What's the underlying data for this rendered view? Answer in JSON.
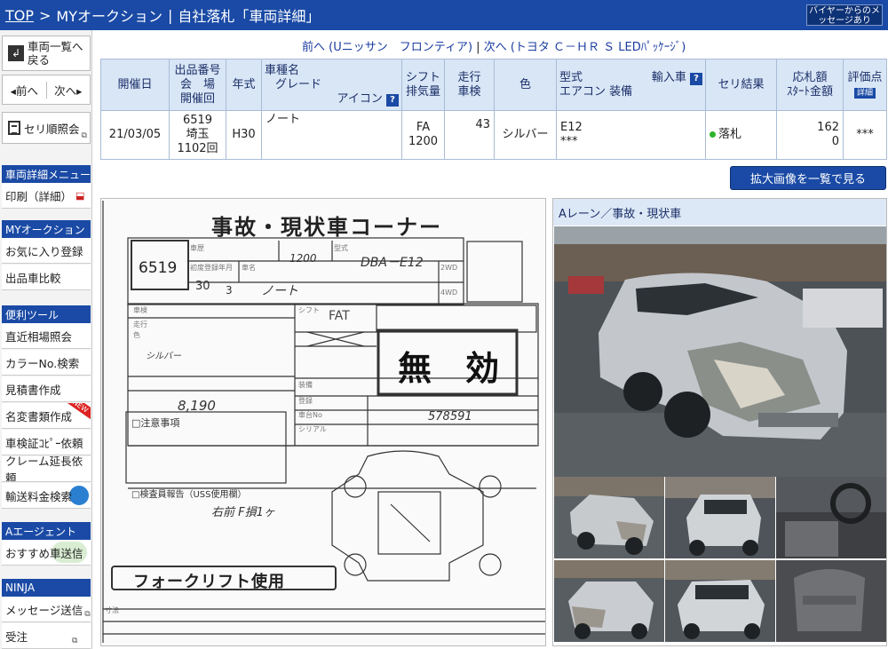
{
  "header": {
    "top": "TOP",
    "sep1": ">",
    "page": "MYオークション",
    "sep2": "|",
    "title": "自社落札「車両詳細」",
    "message_btn": "バイヤーからのメッセージあり"
  },
  "sidebar": {
    "back": "車両一覧へ戻る",
    "prev": "◂前へ",
    "next": "次へ▸",
    "seri": "セリ順照会",
    "menu_head": "車両詳細メニュー",
    "print": "印刷（詳細）",
    "myauction_head": "MYオークション",
    "favorite": "お気に入り登録",
    "compare": "出品車比較",
    "tools_head": "便利ツール",
    "market": "直近相場照会",
    "color_search": "カラーNo.検索",
    "estimate": "見積書作成",
    "name_change": "名変書類作成",
    "inspection_copy": "車検証ｺﾋﾟｰ依頼",
    "claim": "クレーム延長依頼",
    "shipping": "輸送料金検索",
    "new_badge": "NEW",
    "agent_head": "Aエージェント",
    "recommend": "おすすめ車送信",
    "ninja_head": "NINJA",
    "send_msg": "メッセージ送信",
    "receive": "受注"
  },
  "nav": {
    "prev": "前へ (Uニッサン　フロンティア)",
    "separator": "|",
    "next": "次へ (トヨタ Ｃ－ＨＲ Ｓ LEDﾊﾟｯｹｰｼﾞ)"
  },
  "table": {
    "headers": {
      "date": "開催日",
      "lot": [
        "出品番号",
        "会　場",
        "開催回"
      ],
      "year": "年式",
      "model": [
        "車種名",
        "グレード",
        "アイコン"
      ],
      "shift": [
        "シフト",
        "排気量"
      ],
      "mileage": [
        "走行",
        "車検"
      ],
      "color": "色",
      "type": [
        "型式",
        "輸入車",
        "エアコン 装備"
      ],
      "result": "セリ結果",
      "price": [
        "応札額",
        "ｽﾀｰﾄ金額"
      ],
      "rating": "評価点",
      "rating_badge": "詳細"
    },
    "row": {
      "date": "21/03/05",
      "lot_no": "6519",
      "venue": "埼玉",
      "session": "1102回",
      "year": "H30",
      "model": "ノート",
      "shift": "FA",
      "displacement": "1200",
      "mileage": "43",
      "color": "シルバー",
      "type_code": "E12",
      "type_extra": "***",
      "result": "落札",
      "price": "162",
      "start_price": "0",
      "rating": "***"
    }
  },
  "zoom_btn": "拡大画像を一覧で見る",
  "photos": {
    "title": "Aレーン／事故・現状車"
  },
  "sheet": {
    "title": "事故・現状車コーナー",
    "lot_no": "6519",
    "cc": "1200",
    "type": "DBA－E12",
    "year_num": "30",
    "month": "3",
    "model_name": "ノート",
    "shift": "FAT",
    "invalid": "無　効",
    "forklift": "フォークリフト使用",
    "mileage_hand": "8,190",
    "chassis": "578591",
    "inspection_report": "□検査員報告（USS使用欄）",
    "notes": "□注意事項",
    "color_label": "シルバー",
    "hand_note": "右前 F損1ヶ"
  }
}
